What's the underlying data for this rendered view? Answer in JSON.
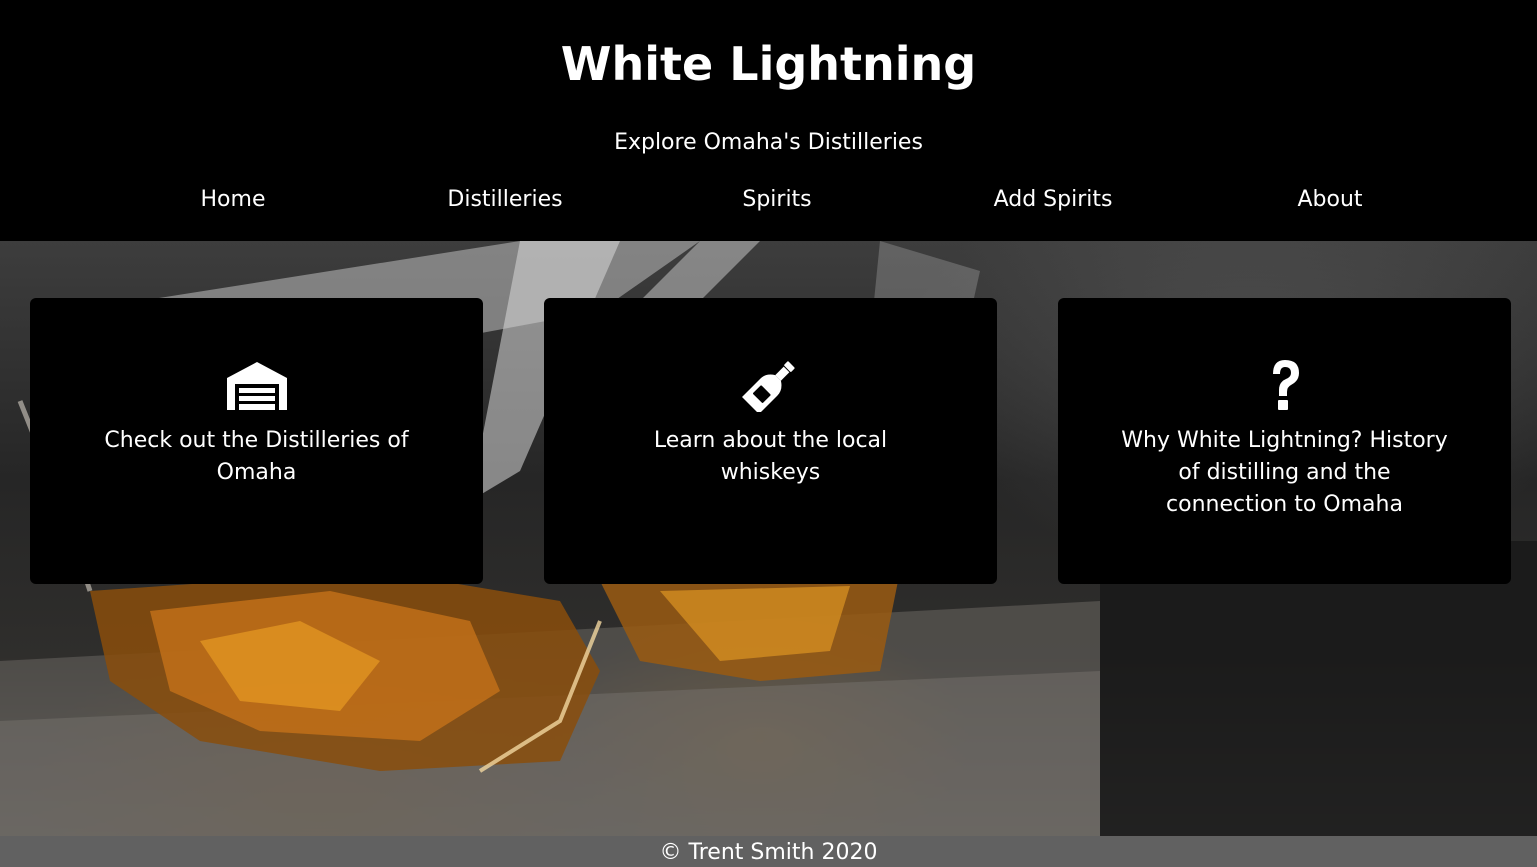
{
  "header": {
    "title": "White Lightning",
    "tagline": "Explore Omaha's Distilleries"
  },
  "nav": {
    "items": [
      {
        "label": "Home"
      },
      {
        "label": "Distilleries"
      },
      {
        "label": "Spirits"
      },
      {
        "label": "Add Spirits"
      },
      {
        "label": "About"
      }
    ]
  },
  "cards": [
    {
      "icon": "warehouse-icon",
      "text": "Check out the Distilleries of Omaha"
    },
    {
      "icon": "wine-bottle-icon",
      "text": "Learn about the local whiskeys"
    },
    {
      "icon": "question-icon",
      "text": "Why White Lightning? History of distilling and the connection to Omaha"
    }
  ],
  "footer": {
    "copyright": "© Trent Smith 2020"
  },
  "colors": {
    "header_bg": "#000000",
    "card_bg": "#000000",
    "footer_bg": "#616161",
    "text": "#ffffff"
  }
}
